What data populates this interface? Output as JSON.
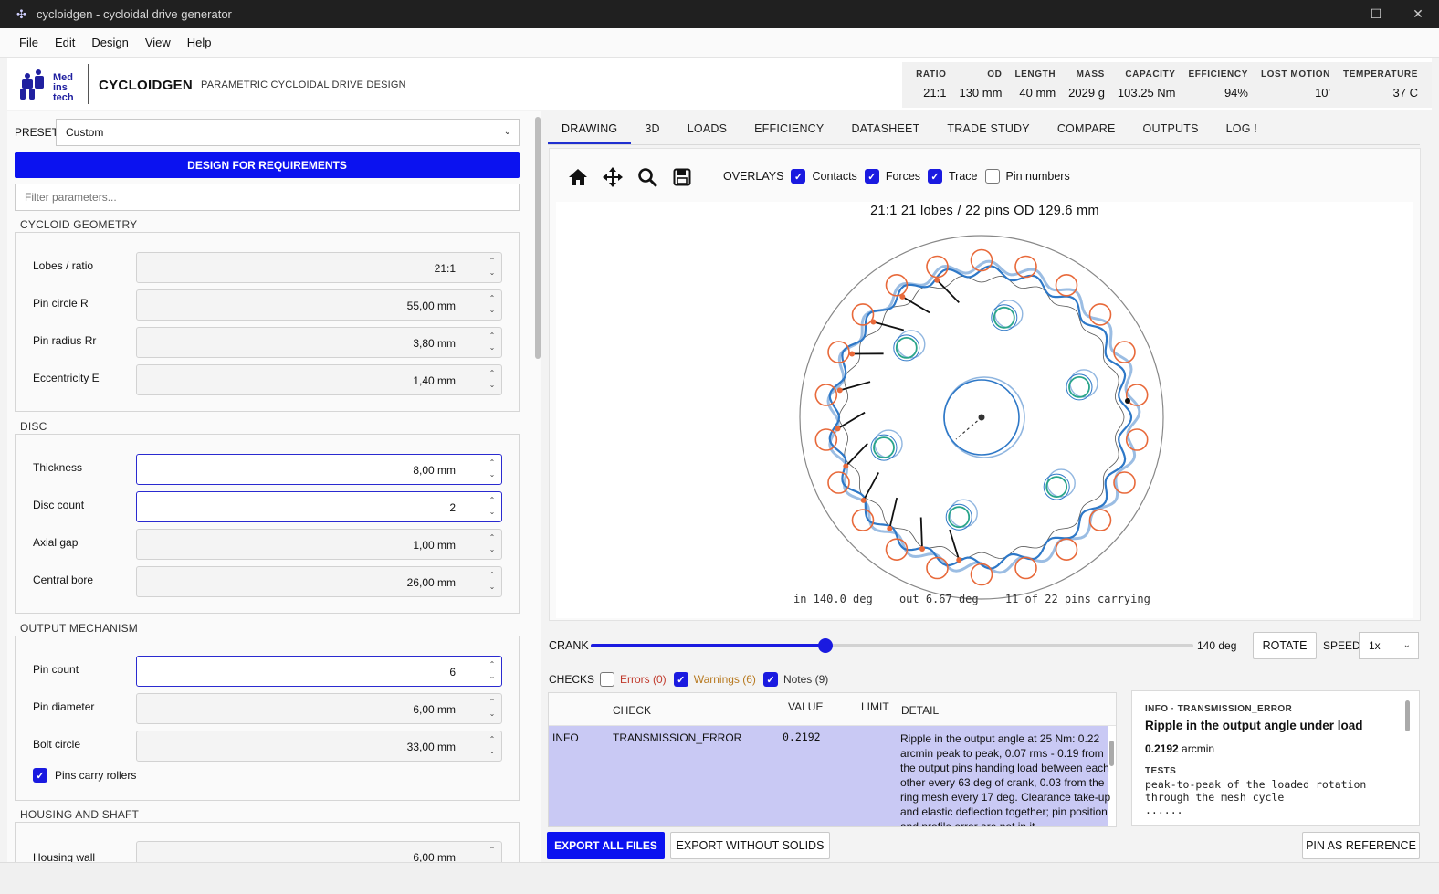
{
  "window": {
    "title": "cycloidgen - cycloidal drive generator",
    "controls": [
      "—",
      "☐",
      "✕"
    ]
  },
  "menu": [
    "File",
    "Edit",
    "Design",
    "View",
    "Help"
  ],
  "header": {
    "logo_text": [
      "Med",
      "ins",
      "tech"
    ],
    "brand": "CYCLOIDGEN",
    "subtitle": "PARAMETRIC CYCLOIDAL DRIVE DESIGN",
    "metrics": [
      {
        "label": "RATIO",
        "value": "21:1"
      },
      {
        "label": "OD",
        "value": "130 mm"
      },
      {
        "label": "LENGTH",
        "value": "40 mm"
      },
      {
        "label": "MASS",
        "value": "2029 g"
      },
      {
        "label": "CAPACITY",
        "value": "103.25 Nm"
      },
      {
        "label": "EFFICIENCY",
        "value": "94%"
      },
      {
        "label": "LOST MOTION",
        "value": "10'"
      },
      {
        "label": "TEMPERATURE",
        "value": "37 C"
      }
    ]
  },
  "left": {
    "preset_label": "PRESET",
    "preset_value": "Custom",
    "design_button": "DESIGN FOR REQUIREMENTS",
    "filter_placeholder": "Filter parameters...",
    "sections": {
      "geometry": {
        "title": "CYCLOID GEOMETRY",
        "rows": [
          {
            "label": "Lobes / ratio",
            "value": "21:1"
          },
          {
            "label": "Pin circle R",
            "value": "55,00 mm"
          },
          {
            "label": "Pin radius Rr",
            "value": "3,80 mm"
          },
          {
            "label": "Eccentricity E",
            "value": "1,40 mm"
          }
        ]
      },
      "disc": {
        "title": "DISC",
        "rows": [
          {
            "label": "Thickness",
            "value": "8,00 mm"
          },
          {
            "label": "Disc count",
            "value": "2"
          },
          {
            "label": "Axial gap",
            "value": "1,00 mm"
          },
          {
            "label": "Central bore",
            "value": "26,00 mm"
          }
        ]
      },
      "output": {
        "title": "OUTPUT MECHANISM",
        "rows": [
          {
            "label": "Pin count",
            "value": "6"
          },
          {
            "label": "Pin diameter",
            "value": "6,00 mm"
          },
          {
            "label": "Bolt circle",
            "value": "33,00 mm"
          }
        ],
        "checkbox": "Pins carry rollers"
      },
      "housing": {
        "title": "HOUSING AND SHAFT",
        "rows": [
          {
            "label": "Housing wall",
            "value": "6,00 mm"
          }
        ]
      }
    }
  },
  "tabs": [
    "DRAWING",
    "3D",
    "LOADS",
    "EFFICIENCY",
    "DATASHEET",
    "TRADE STUDY",
    "COMPARE",
    "OUTPUTS",
    "LOG !"
  ],
  "drawing": {
    "tool_icons": [
      "home-icon",
      "pan-icon",
      "zoom-icon",
      "save-icon"
    ],
    "overlays_label": "OVERLAYS",
    "overlays": [
      {
        "label": "Contacts",
        "checked": true
      },
      {
        "label": "Forces",
        "checked": true
      },
      {
        "label": "Trace",
        "checked": true
      },
      {
        "label": "Pin numbers",
        "checked": false
      }
    ],
    "title": "21:1   21 lobes / 22 pins   OD 129.6 mm",
    "foot_in": "in  140.0 deg",
    "foot_out": "out  6.67 deg",
    "foot_pins": "11 of 22 pins carrying",
    "pin_count": 22,
    "loaded_pins": 11,
    "output_holes": 6,
    "colors": {
      "pin": "#e8693a",
      "disc": "#2e78c7",
      "disc_light": "#90b6e0",
      "hole": "#2aa58a",
      "housing": "#888888"
    }
  },
  "crank": {
    "label": "CRANK",
    "value_text": "140 deg",
    "fraction": 0.39,
    "rotate_label": "ROTATE",
    "speed_label": "SPEED",
    "speed_value": "1x"
  },
  "checks": {
    "label": "CHECKS",
    "filters": [
      {
        "label": "Errors (0)",
        "checked": false,
        "color": "#c0392b"
      },
      {
        "label": "Warnings (6)",
        "checked": true,
        "color": "#b7791f"
      },
      {
        "label": "Notes (9)",
        "checked": true,
        "color": "#333333"
      }
    ],
    "columns": {
      "check": "CHECK",
      "value": "VALUE",
      "limit": "LIMIT",
      "detail": "DETAIL"
    },
    "row": {
      "level": "INFO",
      "check": "TRANSMISSION_ERROR",
      "value": "0.2192",
      "limit": "",
      "detail": "Ripple in the output angle at 25 Nm: 0.22 arcmin peak to peak, 0.07 rms - 0.19 from the output pins handing load between each other every 63 deg of crank, 0.03 from the ring mesh every 17 deg. Clearance take-up and elastic deflection together; pin position and profile error are not in it."
    }
  },
  "info": {
    "kicker": "INFO · TRANSMISSION_ERROR",
    "title": "Ripple in the output angle under load",
    "value": "0.2192",
    "unit": "arcmin",
    "tests_label": "TESTS",
    "tests_text": "peak-to-peak of the loaded rotation through the mesh cycle",
    "more": "......"
  },
  "bottom": {
    "export_all": "EXPORT ALL FILES",
    "export_no_solids": "EXPORT WITHOUT SOLIDS",
    "pin_reference": "PIN AS REFERENCE"
  }
}
